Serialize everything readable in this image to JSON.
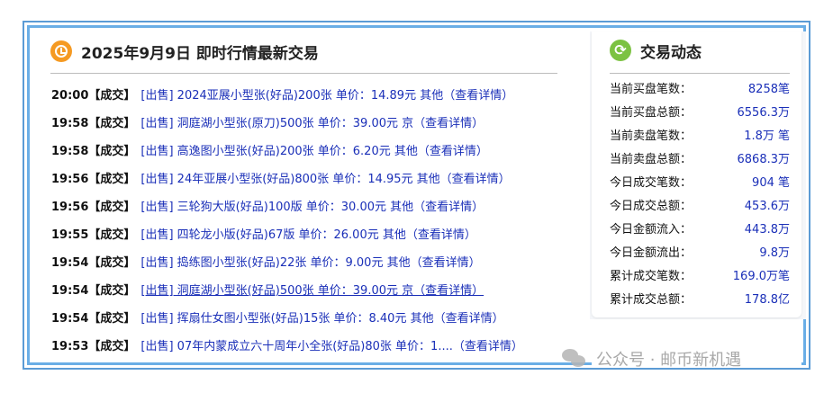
{
  "left": {
    "title": "2025年9月9日 即时行情最新交易",
    "trades": [
      {
        "time": "20:00",
        "status": "【成交】",
        "text": "[出售] 2024亚展小型张(好品)200张 单价：14.89元 其他（查看详情）"
      },
      {
        "time": "19:58",
        "status": "【成交】",
        "text": "[出售] 洞庭湖小型张(原刀)500张 单价：39.00元 京（查看详情）"
      },
      {
        "time": "19:58",
        "status": "【成交】",
        "text": "[出售] 高逸图小型张(好品)200张 单价：6.20元 其他（查看详情）"
      },
      {
        "time": "19:56",
        "status": "【成交】",
        "text": "[出售] 24年亚展小型张(好品)800张 单价：14.95元 其他（查看详情）"
      },
      {
        "time": "19:56",
        "status": "【成交】",
        "text": "[出售] 三轮狗大版(好品)100版 单价：30.00元 其他（查看详情）"
      },
      {
        "time": "19:55",
        "status": "【成交】",
        "text": "[出售] 四轮龙小版(好品)67版 单价：26.00元 其他（查看详情）"
      },
      {
        "time": "19:54",
        "status": "【成交】",
        "text": "[出售] 捣练图小型张(好品)22张 单价：9.00元 其他（查看详情）"
      },
      {
        "time": "19:54",
        "status": "【成交】",
        "text": "[出售] 洞庭湖小型张(好品)500张 单价：39.00元 京（查看详情）"
      },
      {
        "time": "19:54",
        "status": "【成交】",
        "text": "[出售] 挥扇仕女图小型张(好品)15张 单价：8.40元 其他（查看详情）"
      },
      {
        "time": "19:53",
        "status": "【成交】",
        "text": "[出售] 07年内蒙成立六十周年小全张(好品)80张 单价：1....（查看详情）"
      }
    ]
  },
  "right": {
    "title": "交易动态",
    "stats": [
      {
        "label": "当前买盘笔数：",
        "value": "8258笔"
      },
      {
        "label": "当前买盘总额：",
        "value": "6556.3万"
      },
      {
        "label": "当前卖盘笔数：",
        "value": "1.8万 笔"
      },
      {
        "label": "当前卖盘总额：",
        "value": "6868.3万"
      },
      {
        "label": "今日成交笔数：",
        "value": "904 笔"
      },
      {
        "label": "今日成交总额：",
        "value": "453.6万"
      },
      {
        "label": "今日金额流入：",
        "value": "443.8万"
      },
      {
        "label": "今日金额流出：",
        "value": "9.8万"
      },
      {
        "label": "累计成交笔数：",
        "value": "169.0万笔"
      },
      {
        "label": "累计成交总额：",
        "value": "178.8亿"
      }
    ]
  },
  "watermark": {
    "text": "公众号 · 邮币新机遇"
  },
  "colors": {
    "accent": "#1a2fb8",
    "border": "#6aaee6",
    "clock": "#f59a23",
    "refresh": "#7cc242"
  }
}
